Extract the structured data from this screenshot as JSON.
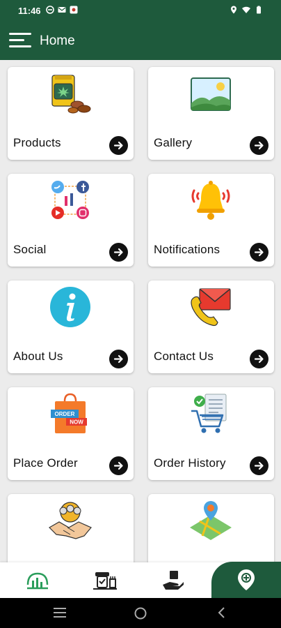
{
  "status_bar": {
    "time": "11:46",
    "left_icons": [
      "sync-icon",
      "mail-icon",
      "app-notification-icon"
    ],
    "right_icons": [
      "location-icon",
      "wifi-icon",
      "battery-icon"
    ]
  },
  "app_bar": {
    "title": "Home",
    "menu_icon": "hamburger-menu-icon",
    "color": "#1e5a3c"
  },
  "tiles": [
    {
      "label": "Products",
      "icon": "products-pack-icon"
    },
    {
      "label": "Gallery",
      "icon": "gallery-image-icon"
    },
    {
      "label": "Social",
      "icon": "social-media-icon"
    },
    {
      "label": "Notifications",
      "icon": "bell-icon"
    },
    {
      "label": "About Us",
      "icon": "info-icon"
    },
    {
      "label": "Contact Us",
      "icon": "contact-mail-phone-icon"
    },
    {
      "label": "Place Order",
      "icon": "order-now-bag-icon"
    },
    {
      "label": "Order History",
      "icon": "order-history-cart-icon"
    },
    {
      "label": "",
      "icon": "partnership-handshake-icon"
    },
    {
      "label": "",
      "icon": "map-location-icon"
    }
  ],
  "bottom_nav": {
    "items": [
      "dashboard-chart-icon",
      "delivery-person-icon",
      "hand-gift-icon"
    ],
    "fab_icon": "location-add-icon"
  },
  "system_nav": [
    "recents-icon",
    "home-circle-icon",
    "back-chevron-icon"
  ]
}
